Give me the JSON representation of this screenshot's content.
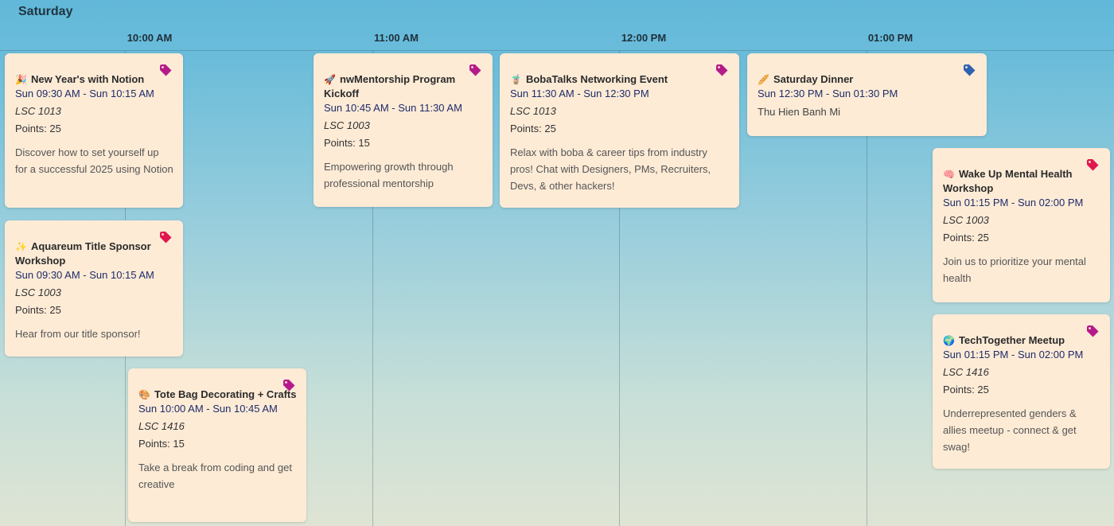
{
  "day": "Saturday",
  "timeline": [
    "10:00 AM",
    "11:00 AM",
    "12:00 PM",
    "01:00 PM"
  ],
  "colors": {
    "card_bg": "#fdebd6",
    "tag_magenta": "#b51a8a",
    "tag_red": "#e0164f",
    "tag_blue": "#2f62b0"
  },
  "events": [
    {
      "emoji": "🎉",
      "title": "New Year's with Notion",
      "time": "Sun 09:30 AM - Sun 10:15 AM",
      "location": "LSC 1013",
      "points": "Points: 25",
      "description": "Discover how to set yourself up for a successful 2025 using Notion",
      "tag_icon": "tag-icon",
      "tag_color": "magenta"
    },
    {
      "emoji": "✨",
      "title": "Aquareum Title Sponsor Workshop",
      "time": "Sun 09:30 AM - Sun 10:15 AM",
      "location": "LSC 1003",
      "points": "Points: 25",
      "description": "Hear from our title sponsor!",
      "tag_icon": "tag-icon",
      "tag_color": "red"
    },
    {
      "emoji": "🎨",
      "title": "Tote Bag Decorating + Crafts",
      "time": "Sun 10:00 AM - Sun 10:45 AM",
      "location": "LSC 1416",
      "points": "Points: 15",
      "description": "Take a break from coding and get creative",
      "tag_icon": "tag-icon",
      "tag_color": "magenta"
    },
    {
      "emoji": "🚀",
      "title": "nwMentorship Program Kickoff",
      "time": "Sun 10:45 AM - Sun 11:30 AM",
      "location": "LSC 1003",
      "points": "Points: 15",
      "description": "Empowering growth through professional mentorship",
      "tag_icon": "tag-icon",
      "tag_color": "magenta"
    },
    {
      "emoji": "🧋",
      "title": "BobaTalks Networking Event",
      "time": "Sun 11:30 AM - Sun 12:30 PM",
      "location": "LSC 1013",
      "points": "Points: 25",
      "description": "Relax with boba & career tips from industry pros! Chat with Designers, PMs, Recruiters, Devs, & other hackers!",
      "tag_icon": "tag-icon",
      "tag_color": "magenta"
    },
    {
      "emoji": "🥖",
      "title": "Saturday Dinner",
      "time": "Sun 12:30 PM - Sun 01:30 PM",
      "location": "",
      "points": "",
      "description": "Thu Hien Banh Mi",
      "tag_icon": "tag-icon",
      "tag_color": "blue"
    },
    {
      "emoji": "🧠",
      "title": "Wake Up Mental Health Workshop",
      "time": "Sun 01:15 PM - Sun 02:00 PM",
      "location": "LSC 1003",
      "points": "Points: 25",
      "description": "Join us to prioritize your mental health",
      "tag_icon": "tag-icon",
      "tag_color": "red"
    },
    {
      "emoji": "🌍",
      "title": "TechTogether Meetup",
      "time": "Sun 01:15 PM - Sun 02:00 PM",
      "location": "LSC 1416",
      "points": "Points: 25",
      "description": "Underrepresented genders & allies meetup - connect & get swag!",
      "tag_icon": "tag-icon",
      "tag_color": "magenta"
    }
  ]
}
